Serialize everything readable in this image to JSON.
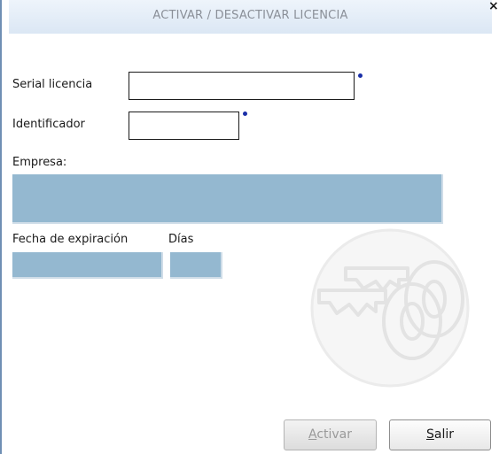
{
  "window": {
    "title": "ACTIVAR / DESACTIVAR  LICENCIA",
    "close_glyph": "×"
  },
  "form": {
    "serial_label": "Serial licencia",
    "serial_value": "",
    "identificador_label": "Identificador",
    "identificador_value": "",
    "empresa_label": "Empresa:",
    "empresa_value": "",
    "fecha_label": "Fecha de expiración",
    "fecha_value": "",
    "dias_label": "Días",
    "dias_value": ""
  },
  "buttons": {
    "activar": {
      "mnemonic": "A",
      "rest": "ctivar",
      "enabled": false
    },
    "salir": {
      "mnemonic": "S",
      "rest": "alir",
      "enabled": true
    }
  },
  "icons": {
    "required": "required-dot-icon",
    "watermark": "keys-watermark-icon"
  },
  "colors": {
    "readonly_fill": "#94b8d0",
    "required_dot": "#1a2fa8",
    "title_text": "#8a8f98"
  }
}
